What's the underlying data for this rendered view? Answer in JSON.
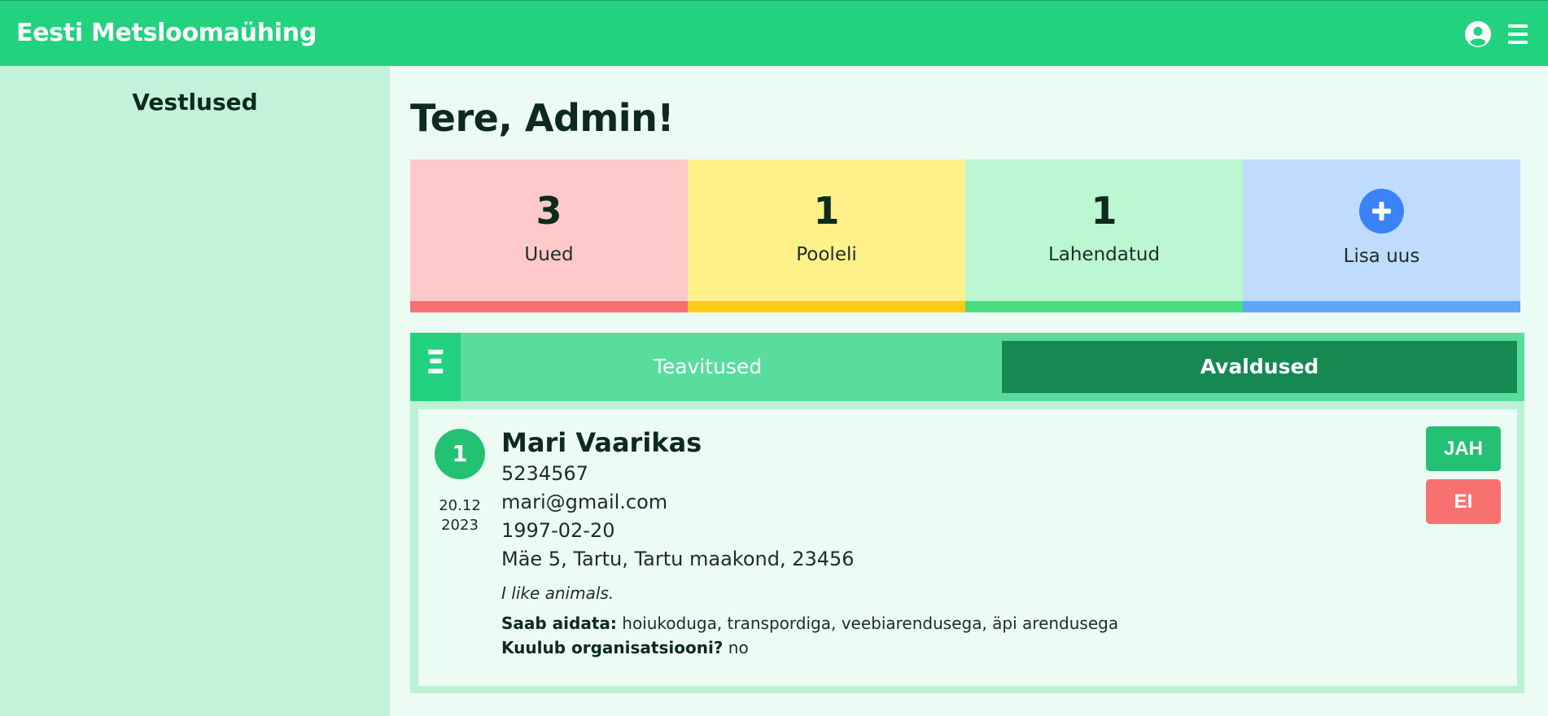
{
  "app": {
    "title": "Eesti Metsloomaühing"
  },
  "sidebar": {
    "title": "Vestlused"
  },
  "main": {
    "greeting": "Tere, Admin!"
  },
  "stats": [
    {
      "count": "3",
      "label": "Uued",
      "color": "#ffc9c9",
      "accent": "#f87171"
    },
    {
      "count": "1",
      "label": "Pooleli",
      "color": "#fff18a",
      "accent": "#facc15"
    },
    {
      "count": "1",
      "label": "Lahendatud",
      "color": "#bbf7d0",
      "accent": "#4ade80"
    },
    {
      "label": "Lisa uus",
      "icon": "plus-icon",
      "color": "#bfdbfe",
      "accent": "#60a5fa"
    }
  ],
  "tabs": {
    "handle": "Ξ",
    "items": [
      {
        "label": "Teavitused",
        "active": false
      },
      {
        "label": "Avaldused",
        "active": true
      }
    ]
  },
  "application": {
    "number": "1",
    "date_day": "20.12",
    "date_year": "2023",
    "name": "Mari Vaarikas",
    "phone": "5234567",
    "email": "mari@gmail.com",
    "birthdate": "1997-02-20",
    "address": "Mäe 5, Tartu, Tartu maakond, 23456",
    "motivation": "I like animals.",
    "help_label": "Saab aidata:",
    "help_value": " hoiukoduga, transpordiga, veebiarendusega, äpi arendusega",
    "org_label": "Kuulub organisatsiooni?",
    "org_value": " no",
    "accept_label": "JAH",
    "reject_label": "EI"
  },
  "colors": {
    "primary": "#22d27f",
    "sidebar": "#c3f2da",
    "background": "#ecfbf3",
    "tab_active": "#168852",
    "accept": "#22c272",
    "reject": "#f87171"
  },
  "icons": {
    "user": "user-circle-icon",
    "menu": "hamburger-menu-icon"
  }
}
